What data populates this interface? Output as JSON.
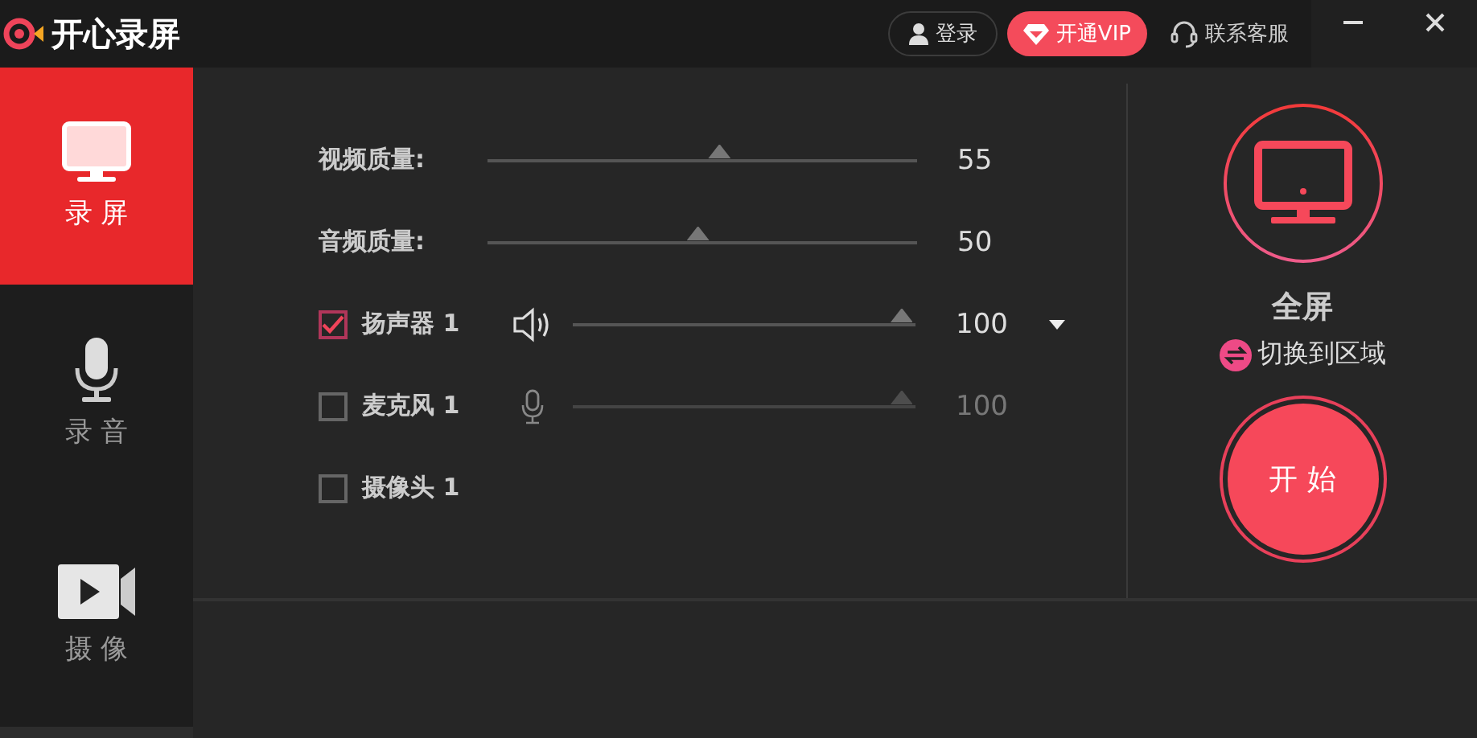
{
  "app": {
    "title": "开心录屏"
  },
  "header": {
    "login": "登录",
    "vip": "开通VIP",
    "support": "联系客服"
  },
  "sidebar": {
    "items": [
      {
        "kind": "screen",
        "label": "录 屏",
        "selected": true
      },
      {
        "kind": "audio",
        "label": "录 音",
        "selected": false
      },
      {
        "kind": "camera",
        "label": "摄 像",
        "selected": false
      }
    ]
  },
  "settings": [
    {
      "kind": "quality",
      "label": "视频质量:",
      "level": 0.54,
      "reading": "55"
    },
    {
      "kind": "quality",
      "label": "音频质量:",
      "level": 0.49,
      "reading": "50"
    },
    {
      "kind": "speaker",
      "label": "扬声器 1",
      "checked": true,
      "disabled": false,
      "level": 0.96,
      "reading": "100",
      "dropdown": true
    },
    {
      "kind": "mic",
      "label": "麦克风 1",
      "checked": false,
      "disabled": true,
      "level": 0.96,
      "reading": "100",
      "dropdown": false
    },
    {
      "kind": "camera",
      "label": "摄像头 1",
      "checked": false
    }
  ],
  "mode": {
    "label": "全屏",
    "switch": "切换到区域",
    "start": "开 始"
  }
}
